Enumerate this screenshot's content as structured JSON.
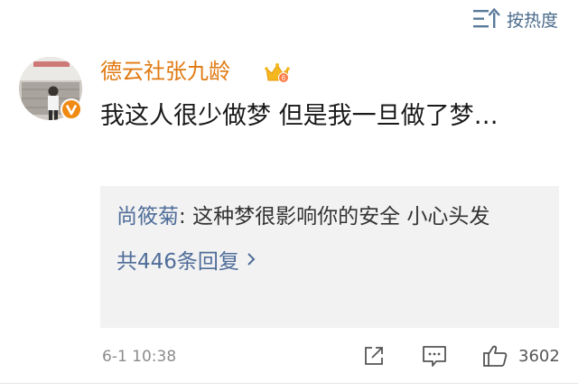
{
  "sort": {
    "label": "按热度",
    "icon": "sort-icon"
  },
  "comment": {
    "username": "德云社张九龄",
    "avatar_icon": "avatar",
    "verified_icon": "verified-v-icon",
    "member_icon": "crown-member-icon",
    "text": "我这人很少做梦  但是我一旦做了梦…",
    "timestamp": "6-1 10:38",
    "like_count": "3602",
    "colors": {
      "username": "#e07a12",
      "link": "#4f6d99",
      "reply_bg": "#f2f2f2"
    }
  },
  "reply": {
    "author": "尚筱菊",
    "separator": ": ",
    "text": "这种梦很影响你的安全 小心头发",
    "more_label": "共446条回复"
  },
  "actions": {
    "share_icon": "share-icon",
    "comment_icon": "comment-icon",
    "like_icon": "like-thumb-icon"
  }
}
